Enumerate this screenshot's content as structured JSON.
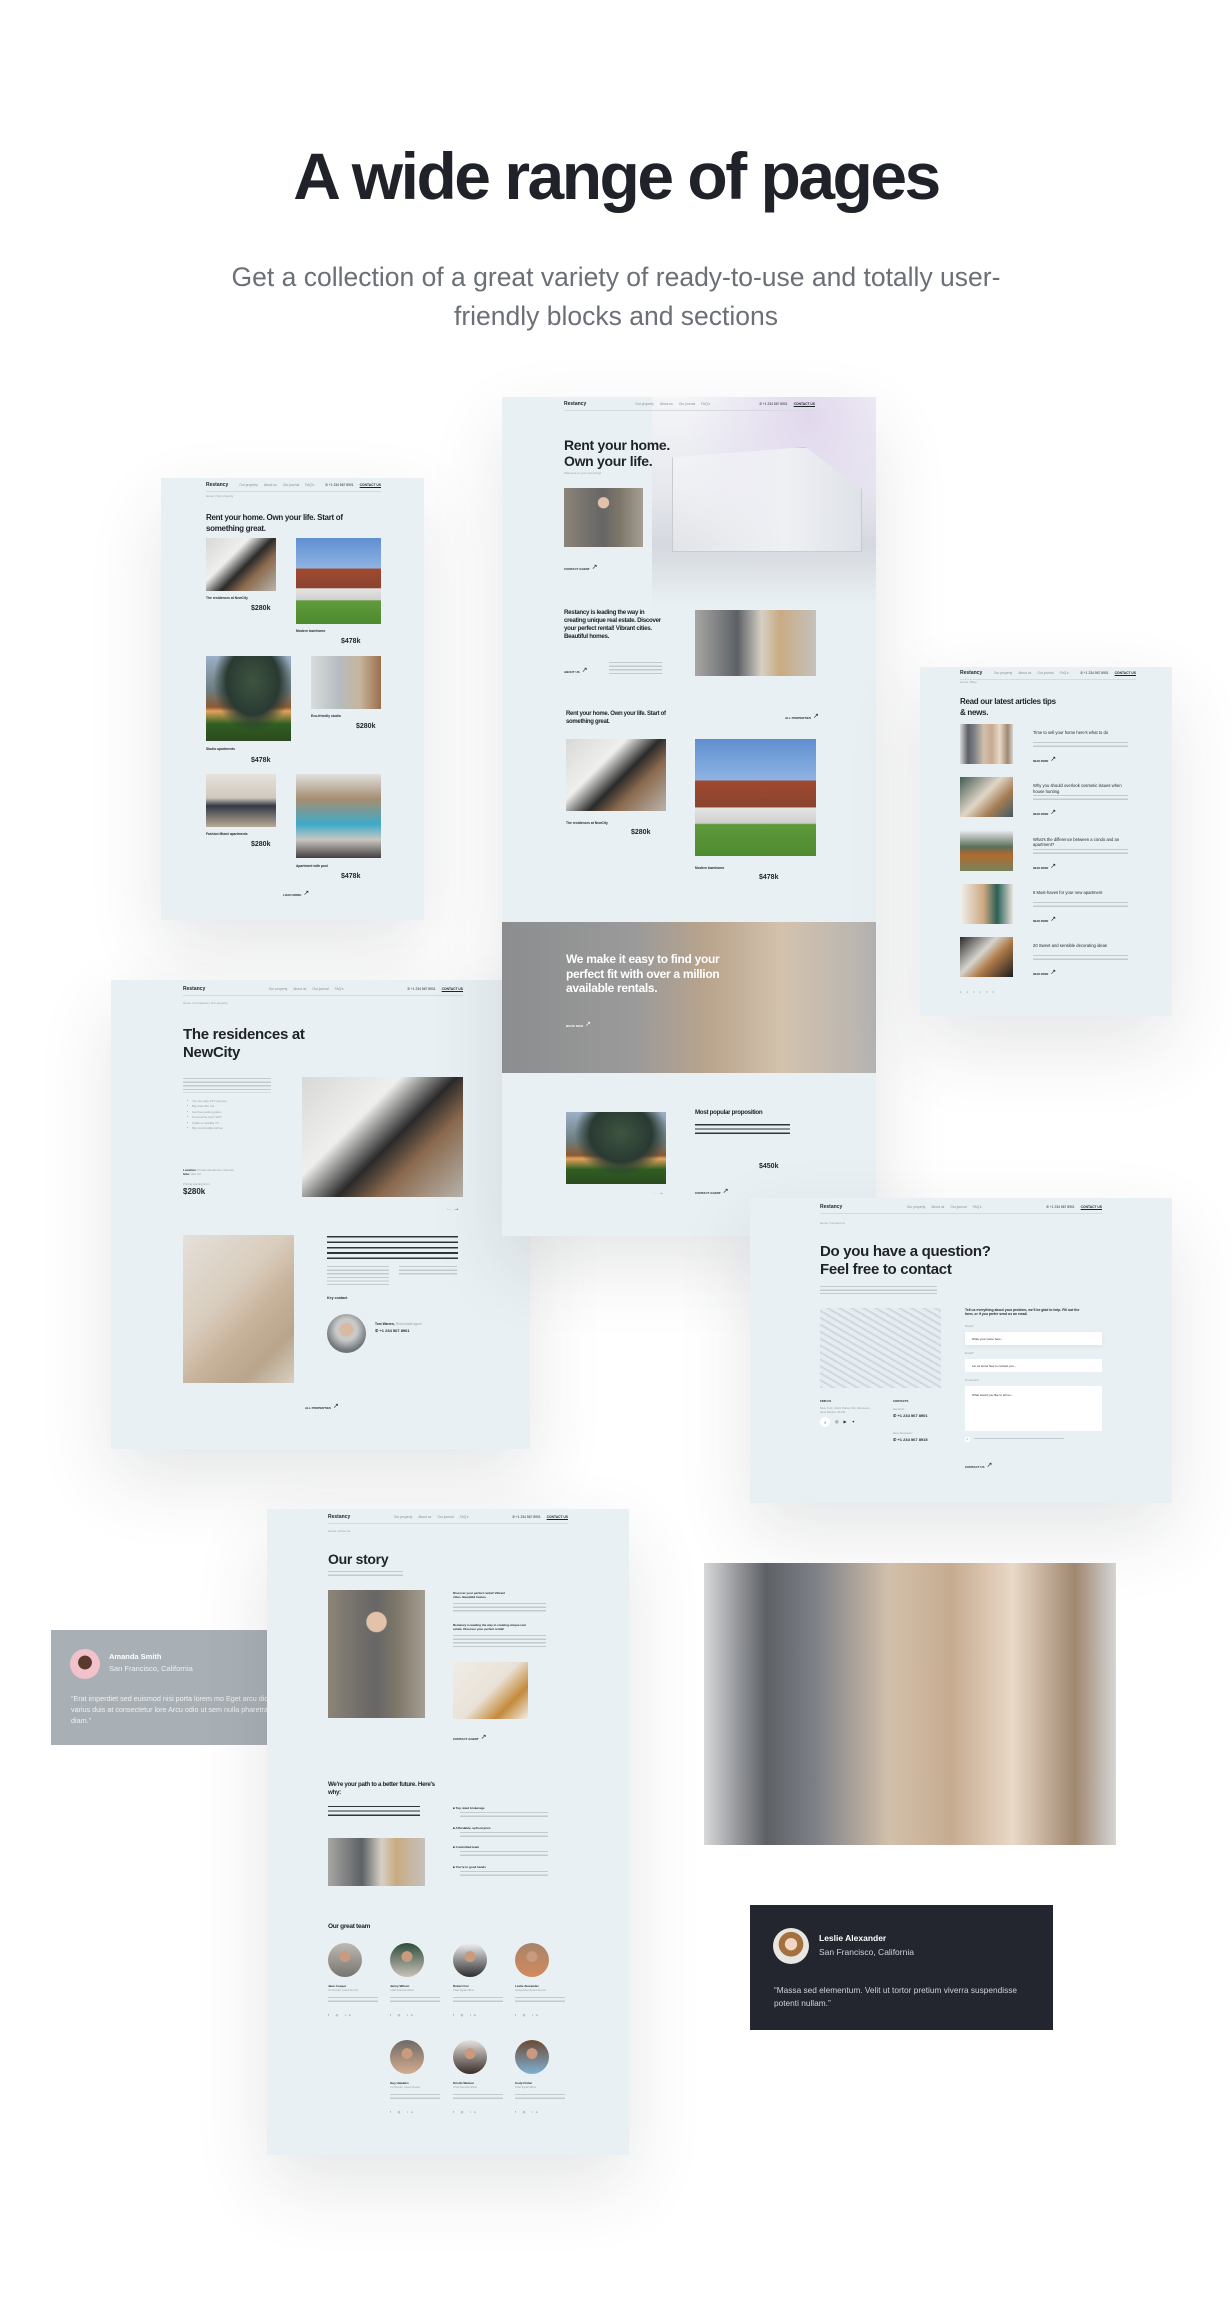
{
  "header": {
    "title": "A wide range of pages",
    "subtitle": "Get a collection of a great variety of ready-to-use and totally user-friendly blocks and sections"
  },
  "nav": {
    "logo": "Restancy",
    "items": [
      "Our property",
      "About us",
      "Our journal",
      "FAQ's"
    ],
    "phone": "+1 234 567 8901",
    "contact": "CONTACT US"
  },
  "home": {
    "hero_title": "Rent your home. Own your life.",
    "hero_sub": "Welcome to your new living!",
    "contact_agent": "CONTACT AGENT",
    "about_title": "Restancy is leading the way in creating unique real estate. Discover your perfect rental! Vibrant cities. Beautiful homes.",
    "about_link": "ABOUT US",
    "props_title": "Rent your home. Own your life. Start of something great.",
    "all_props": "ALL PROPERTIES",
    "props": [
      {
        "name": "The residences at NewCity",
        "price": "$280k"
      },
      {
        "name": "Modern townhome",
        "price": "$478k"
      }
    ],
    "banner_title": "We make it easy to find your perfect fit with over a million available rentals.",
    "banner_link": "BOOK NOW",
    "popular_title": "Most popular proposition",
    "popular_price": "$450k",
    "popular_link": "CONTACT AGENT"
  },
  "listing": {
    "breadcrumb": "Home | Our property",
    "title": "Rent your home. Own your life. Start of something great.",
    "cards": [
      {
        "name": "The residences at NewCity",
        "price": "$280k"
      },
      {
        "name": "Modern townhome",
        "price": "$478k"
      },
      {
        "name": "Studio apartments",
        "price": "$478k"
      },
      {
        "name": "Eco-friendly studio",
        "price": "$280k"
      },
      {
        "name": "Fashion Miami apartments",
        "price": "$280k"
      },
      {
        "name": "Apartment with pool",
        "price": "$478k"
      }
    ],
    "load_more": "LOAD MORE"
  },
  "blog": {
    "breadcrumb": "Home | Blog",
    "title": "Read our latest articles tips & news.",
    "articles": [
      "Time to sell your home here's what to do",
      "Why you should overlook cosmetic issues when house hunting",
      "What's the difference between a condo and an apartment?",
      "6 Must-haves for your new apartment",
      "20 Sweet and sensible decorating ideas"
    ],
    "read_more": "READ MORE"
  },
  "residence": {
    "breadcrumb": "Home | Complexes | Our property",
    "title": "The residences at NewCity",
    "features": [
      "You are safe 24/7 security",
      "Big area 400 m2",
      "Get free parking place",
      "Community room WiFi",
      "Cable or satellite TV",
      "Big comfortable kitchen"
    ],
    "location_label": "Location:",
    "location": "Private Residence, Monaco",
    "size_label": "Size:",
    "size": "400 m2",
    "pricing_label": "Pricing starting from",
    "price": "$280k",
    "key_contact": "Key contact",
    "agent_name": "Tom Warren,",
    "agent_role": "Real estate agent",
    "agent_phone": "+1 234 567 8901",
    "all_props": "ALL PROPERTIES"
  },
  "contact": {
    "breadcrumb": "Home | Contact us",
    "title": "Do you have a question? Feel free to contact",
    "form_intro": "Tell us everything about your problem, we'll be glad to help. Fill out the form, or if you prefer send us an email.",
    "name_label": "Name*",
    "name_placeholder": "Write your name here...",
    "email_label": "Email*",
    "email_placeholder": "Let us know how to contact you...",
    "comment_label": "Comment*",
    "comment_placeholder": "What would you like to tell us...",
    "submit": "CONTACT US",
    "find_us": "FIND US",
    "address": "New York, 4140 Parker Rd. Allentown, New Mexico 31134",
    "contacts": "CONTACTS",
    "general": "General:",
    "general_phone": "+1 234 567 8901",
    "new_business": "New business:",
    "business_phone": "+1 234 567 8915"
  },
  "about": {
    "breadcrumb": "Home | About us",
    "title": "Our story",
    "block1": "Discover your perfect rental! Vibrant cities. Beautiful homes.",
    "block2": "Restancy is leading the way in creating unique real estate. Discover your perfect rental!",
    "contact_agent": "CONTACT AGENT",
    "why_title": "We're your path to a better future. Here's why:",
    "reasons": [
      "Top rated brokerage",
      "Affordable, upfront price",
      "Committed team",
      "You're in good hands"
    ],
    "team_title": "Our great team",
    "team": [
      {
        "name": "Jane Cooper",
        "role": "Co-founder, board director"
      },
      {
        "name": "Jenny Wilson",
        "role": "Chief financial officer"
      },
      {
        "name": "Robert Fox",
        "role": "Chief digital officer"
      },
      {
        "name": "Leslie Alexander",
        "role": "Independent board director"
      },
      {
        "name": "Guy Hawkins",
        "role": "Co-founder, board director"
      },
      {
        "name": "Kristin Watson",
        "role": "Chief financial officer"
      },
      {
        "name": "Cody Fisher",
        "role": "Chief digital officer"
      }
    ]
  },
  "testimonials": [
    {
      "name": "Amanda Smith",
      "location": "San Francisco, California",
      "quote": "“Erat imperdiet sed euismod nisi porta lorem mo Eget arcu dictum varius duis at consectetur lore Arcu odio ut sem nulla pharetra diam.”",
      "bg": "#a9b0b5"
    },
    {
      "name": "Leslie Alexander",
      "location": "San Francisco, California",
      "quote": "“Massa sed elementum. Velit ut tortor pretium viverra suspendisse potenti nullam.”",
      "bg": "#23262e"
    }
  ],
  "colors": {
    "page_bg": "#ffffff",
    "mock_bg": "#e9f0f3",
    "text": "#1f2329",
    "muted": "#6b7076"
  }
}
